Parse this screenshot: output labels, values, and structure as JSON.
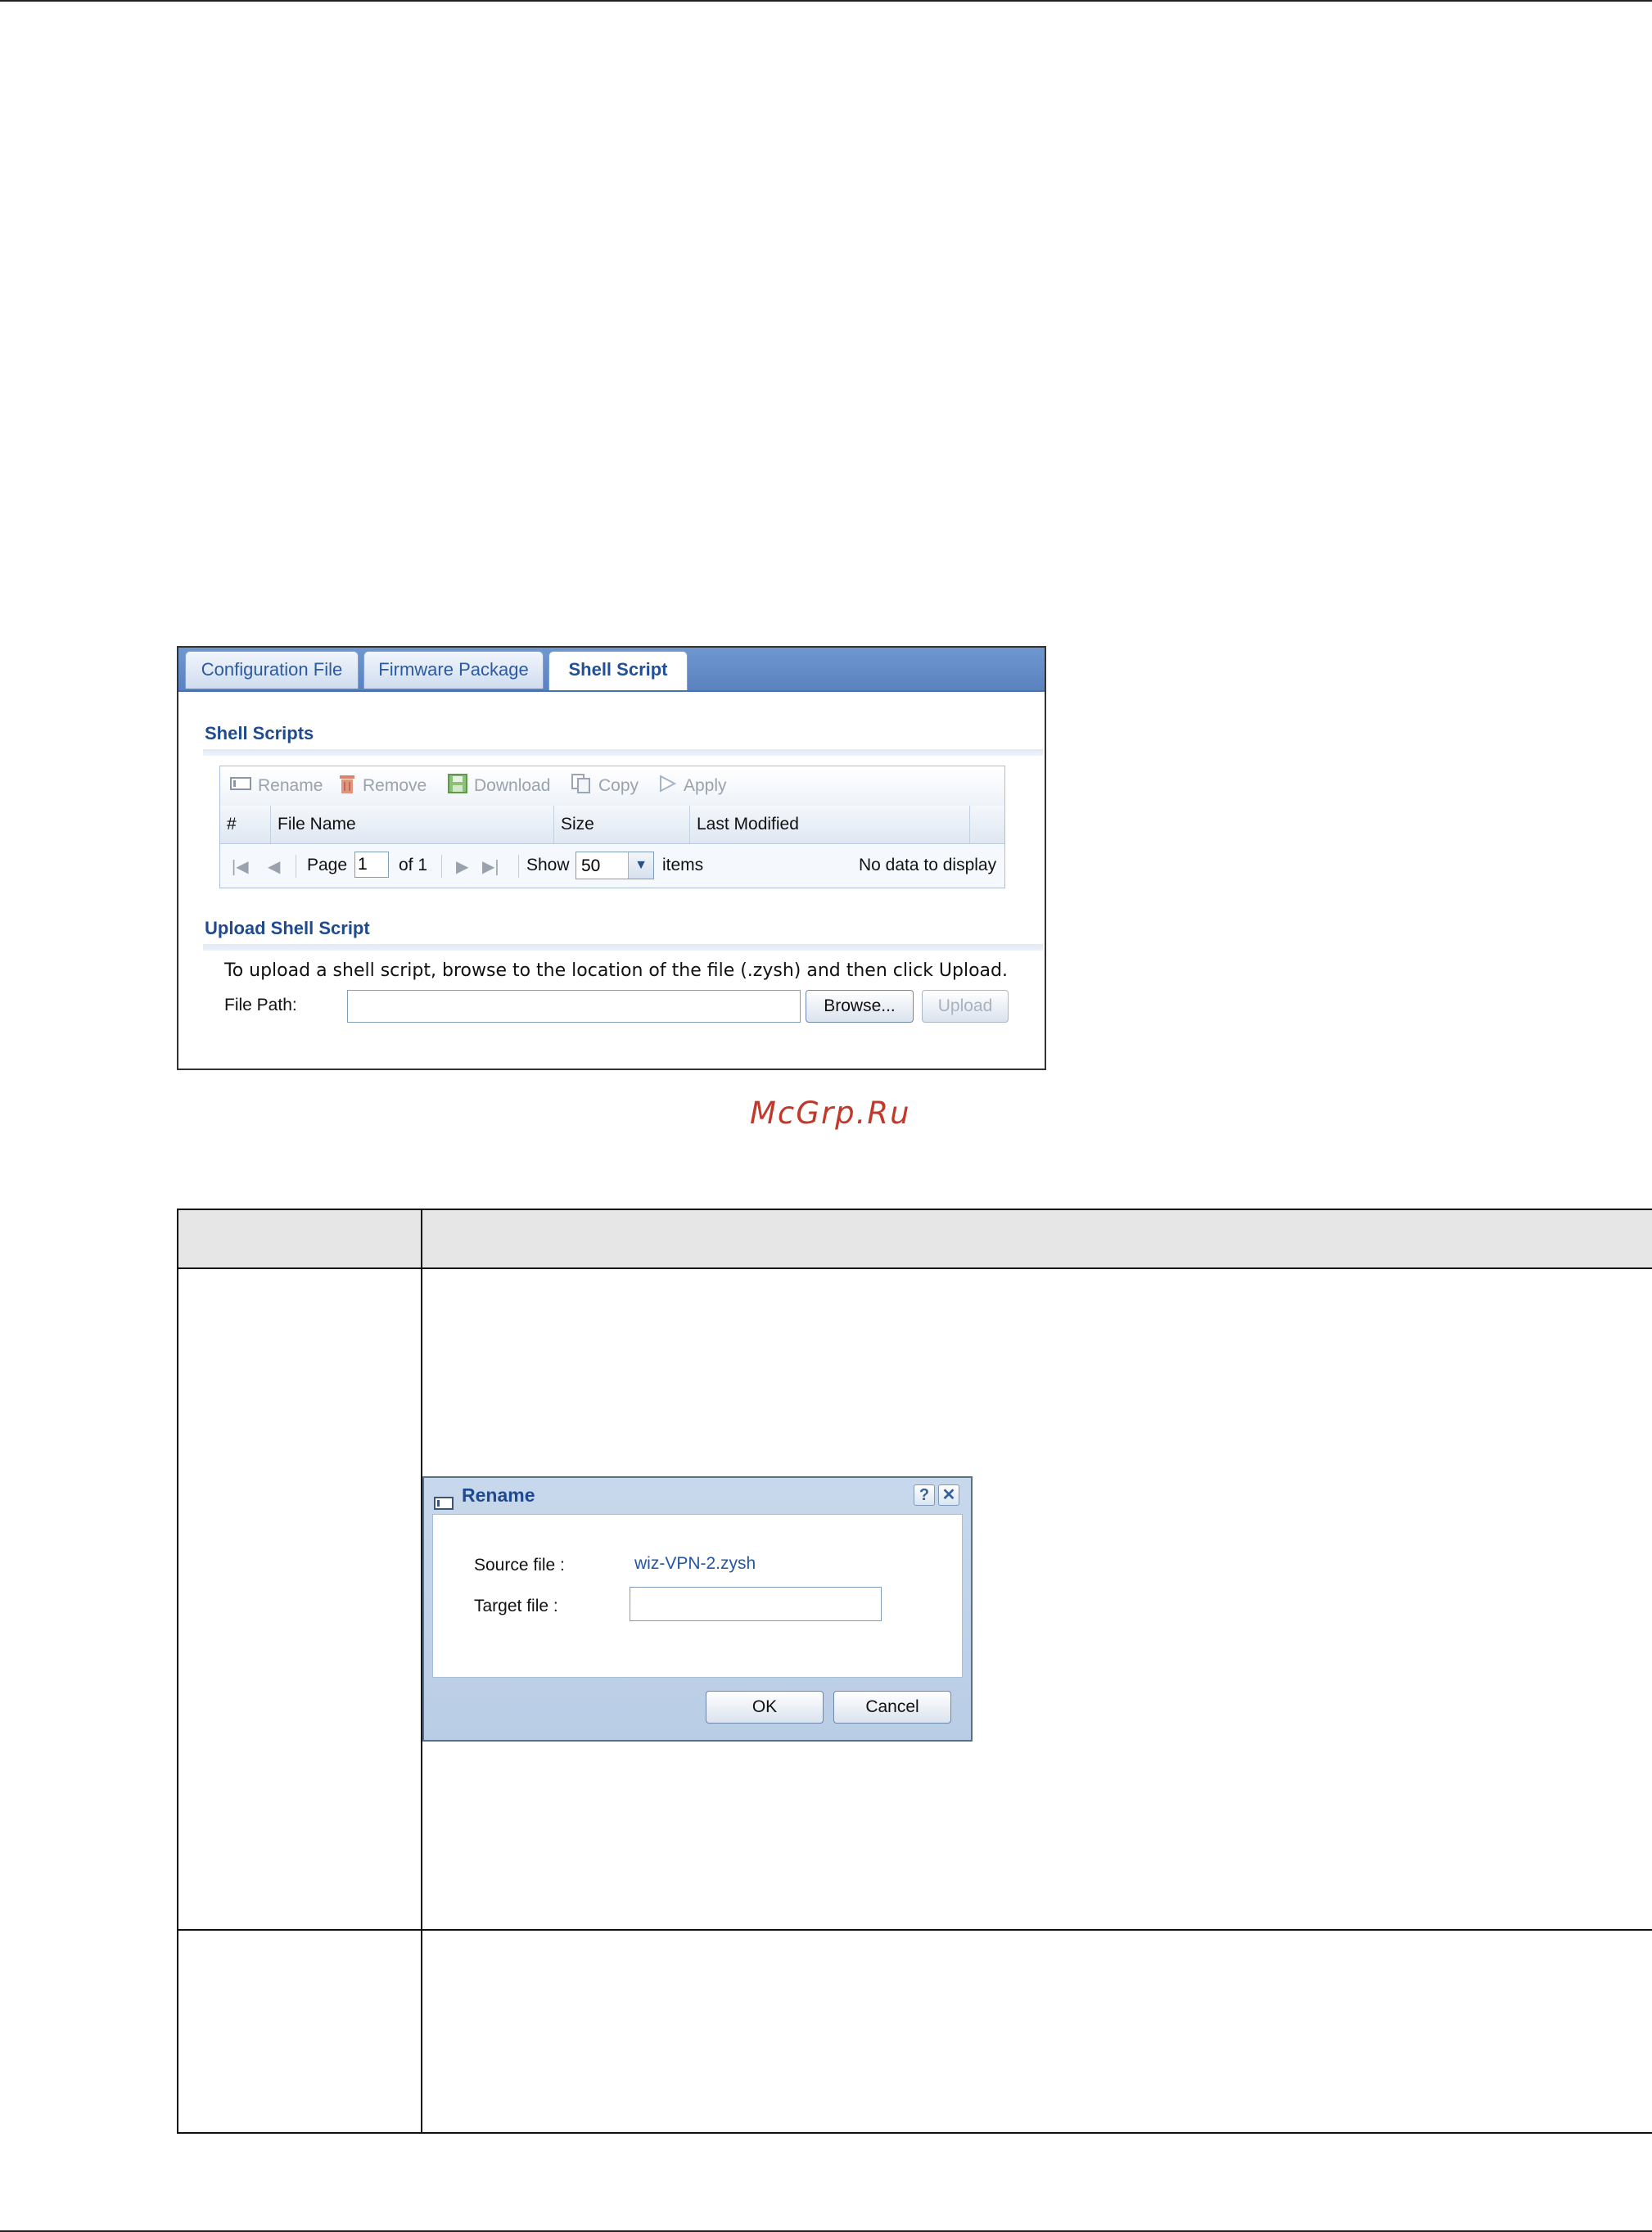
{
  "panel": {
    "tabs": [
      {
        "label": "Configuration File"
      },
      {
        "label": "Firmware Package"
      },
      {
        "label": "Shell Script"
      }
    ],
    "shell_scripts_title": "Shell Scripts",
    "toolbar": {
      "rename": "Rename",
      "remove": "Remove",
      "download": "Download",
      "copy": "Copy",
      "apply": "Apply"
    },
    "columns": {
      "num": "#",
      "file_name": "File Name",
      "size": "Size",
      "last_modified": "Last Modified"
    },
    "pager": {
      "page_label": "Page",
      "page_value": "1",
      "of_label": "of 1",
      "show_label": "Show",
      "show_value": "50",
      "items_label": "items",
      "status": "No data to display"
    },
    "upload": {
      "title": "Upload Shell Script",
      "instruction": "To upload a shell script, browse to the location of the file (.zysh) and then click Upload.",
      "file_path_label": "File Path:",
      "file_path_value": "",
      "browse_label": "Browse...",
      "upload_label": "Upload"
    }
  },
  "watermark": "McGrp.Ru",
  "rename_dialog": {
    "title": "Rename",
    "help": "?",
    "close": "✕",
    "source_label": "Source file :",
    "source_value": "wiz-VPN-2.zysh",
    "target_label": "Target file :",
    "target_value": "",
    "ok_label": "OK",
    "cancel_label": "Cancel"
  },
  "icons": {
    "rename": "rename-icon",
    "remove": "trash-icon",
    "download": "save-icon",
    "copy": "copy-icon",
    "apply": "play-icon"
  },
  "colors": {
    "tab_bar": "#5a82bf",
    "section_title": "#1f4a8e",
    "watermark": "#c0392b"
  }
}
